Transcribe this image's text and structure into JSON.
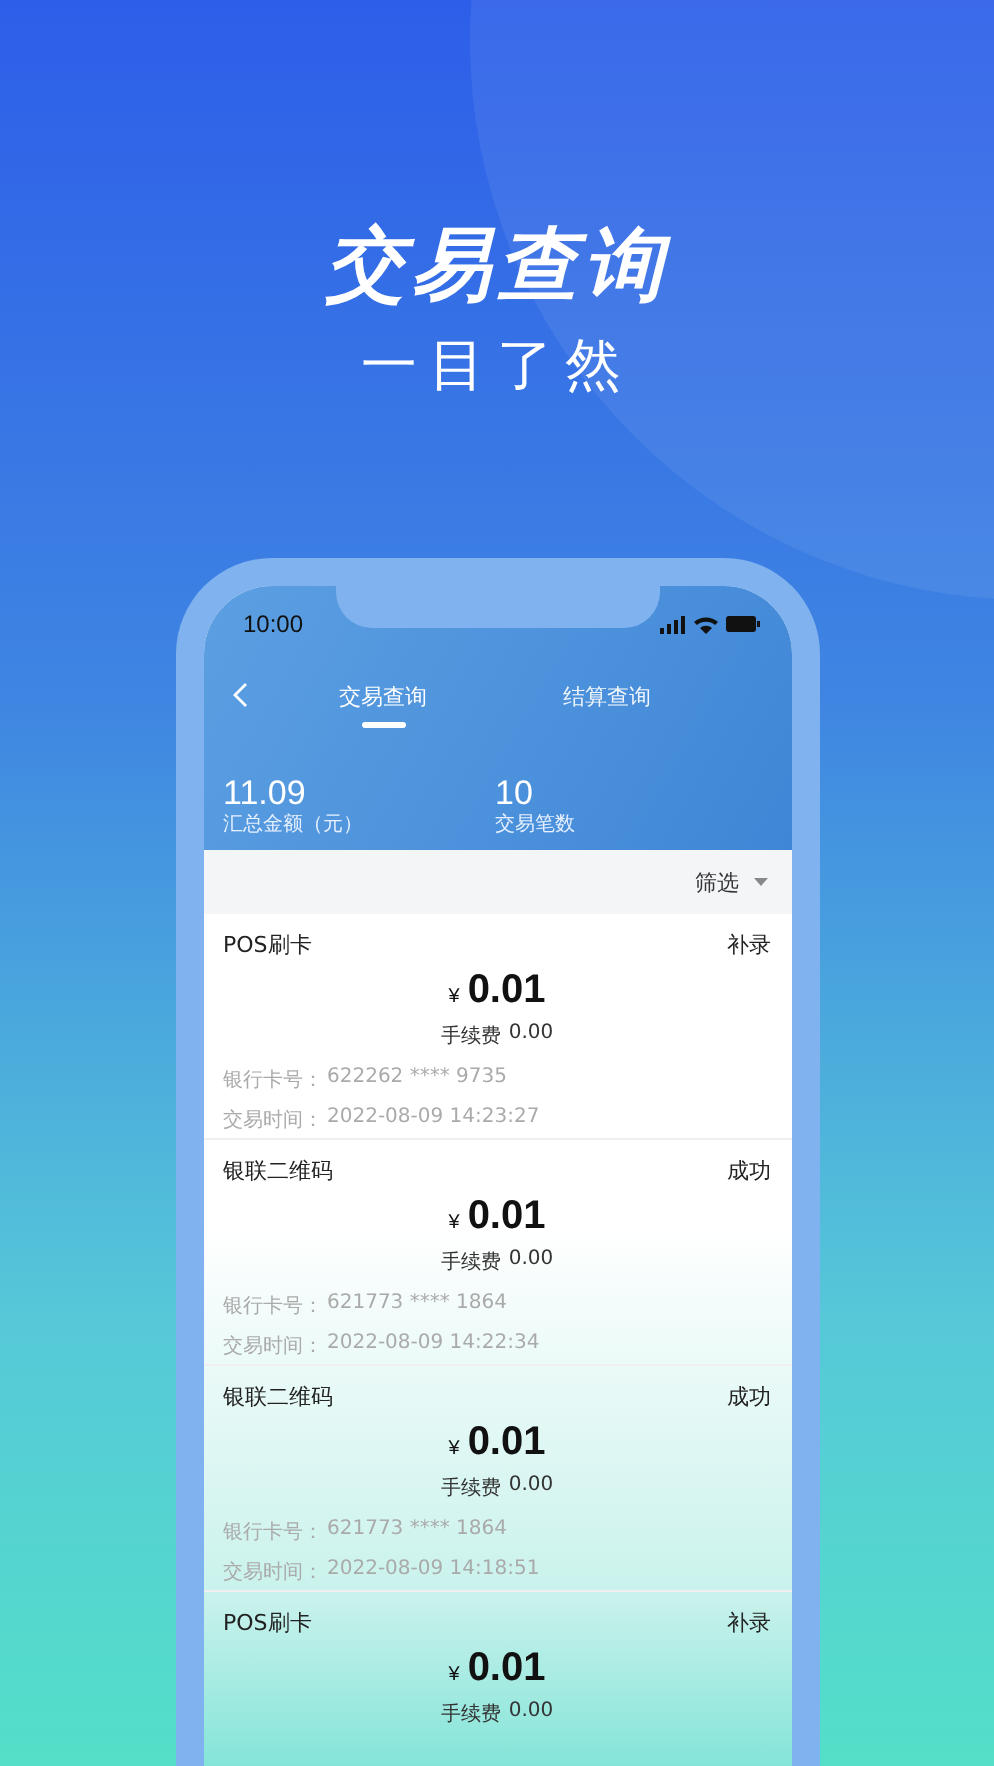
{
  "headline": "交易查询",
  "subheadline": "一目了然",
  "status_bar": {
    "time": "10:00"
  },
  "tabs": [
    {
      "label": "交易查询",
      "selected": true
    },
    {
      "label": "结算查询",
      "selected": false
    }
  ],
  "summary": [
    {
      "value": "11.09",
      "label": "汇总金额（元）"
    },
    {
      "value": "10",
      "label": "交易笔数"
    }
  ],
  "filter": {
    "label": "筛选"
  },
  "transactions": [
    {
      "type": "POS刷卡",
      "status": "补录",
      "currency": "¥",
      "amount": "0.01",
      "fee_label": "手续费",
      "fee": "0.00",
      "card_label": "银行卡号：",
      "card": "622262 **** 9735",
      "time_label": "交易时间：",
      "time": "2022-08-09 14:23:27"
    },
    {
      "type": "银联二维码",
      "status": "成功",
      "currency": "¥",
      "amount": "0.01",
      "fee_label": "手续费",
      "fee": "0.00",
      "card_label": "银行卡号：",
      "card": "621773 **** 1864",
      "time_label": "交易时间：",
      "time": "2022-08-09 14:22:34"
    },
    {
      "type": "银联二维码",
      "status": "成功",
      "currency": "¥",
      "amount": "0.01",
      "fee_label": "手续费",
      "fee": "0.00",
      "card_label": "银行卡号：",
      "card": "621773 **** 1864",
      "time_label": "交易时间：",
      "time": "2022-08-09 14:18:51"
    },
    {
      "type": "POS刷卡",
      "status": "补录",
      "currency": "¥",
      "amount": "0.01",
      "fee_label": "手续费",
      "fee": "0.00"
    }
  ]
}
